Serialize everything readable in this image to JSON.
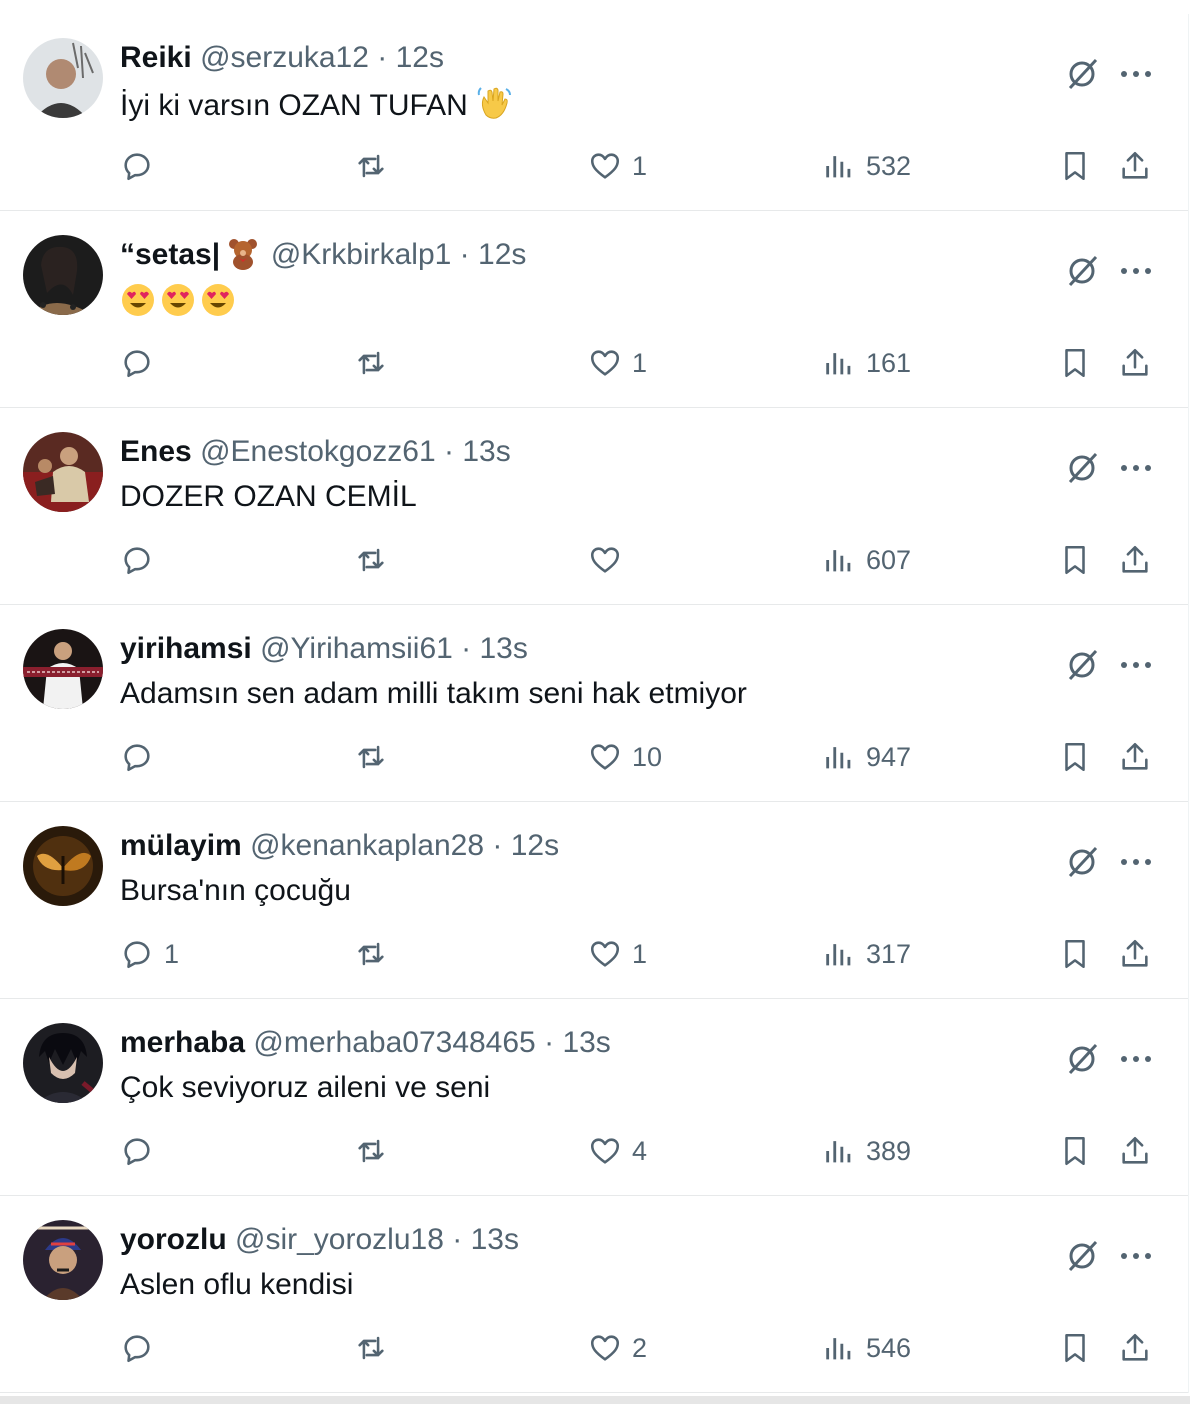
{
  "colors": {
    "text": "#0f1419",
    "secondary": "#536471",
    "divider": "#e7e9ea"
  },
  "tweets": [
    {
      "name": "Reiki",
      "handle": "@serzuka12",
      "sep": "·",
      "time": "12s",
      "text": "İyi ki varsın OZAN TUFAN",
      "emoji": "waving-hand",
      "replies": "",
      "likes": "1",
      "views": "532"
    },
    {
      "name": "“setas|",
      "name_emoji": "teddy-bear",
      "handle": "@Krkbirkalp1",
      "sep": "·",
      "time": "12s",
      "text": "",
      "emoji": "heart-eyes x3",
      "replies": "",
      "likes": "1",
      "views": "161"
    },
    {
      "name": "Enes",
      "handle": "@Enestokgozz61",
      "sep": "·",
      "time": "13s",
      "text": "DOZER OZAN CEMİL",
      "replies": "",
      "likes": "",
      "views": "607"
    },
    {
      "name": "yirihamsi",
      "handle": "@Yirihamsii61",
      "sep": "·",
      "time": "13s",
      "text": "Adamsın sen adam milli takım seni hak etmiyor",
      "replies": "",
      "likes": "10",
      "views": "947"
    },
    {
      "name": "mülayim",
      "handle": "@kenankaplan28",
      "sep": "·",
      "time": "12s",
      "text": "Bursa'nın çocuğu",
      "replies": "1",
      "likes": "1",
      "views": "317"
    },
    {
      "name": "merhaba",
      "handle": "@merhaba07348465",
      "sep": "·",
      "time": "13s",
      "text": "Çok seviyoruz aileni ve seni",
      "replies": "",
      "likes": "4",
      "views": "389"
    },
    {
      "name": "yorozlu",
      "handle": "@sir_yorozlu18",
      "sep": "·",
      "time": "13s",
      "text": "Aslen oflu kendisi",
      "replies": "",
      "likes": "2",
      "views": "546"
    }
  ]
}
